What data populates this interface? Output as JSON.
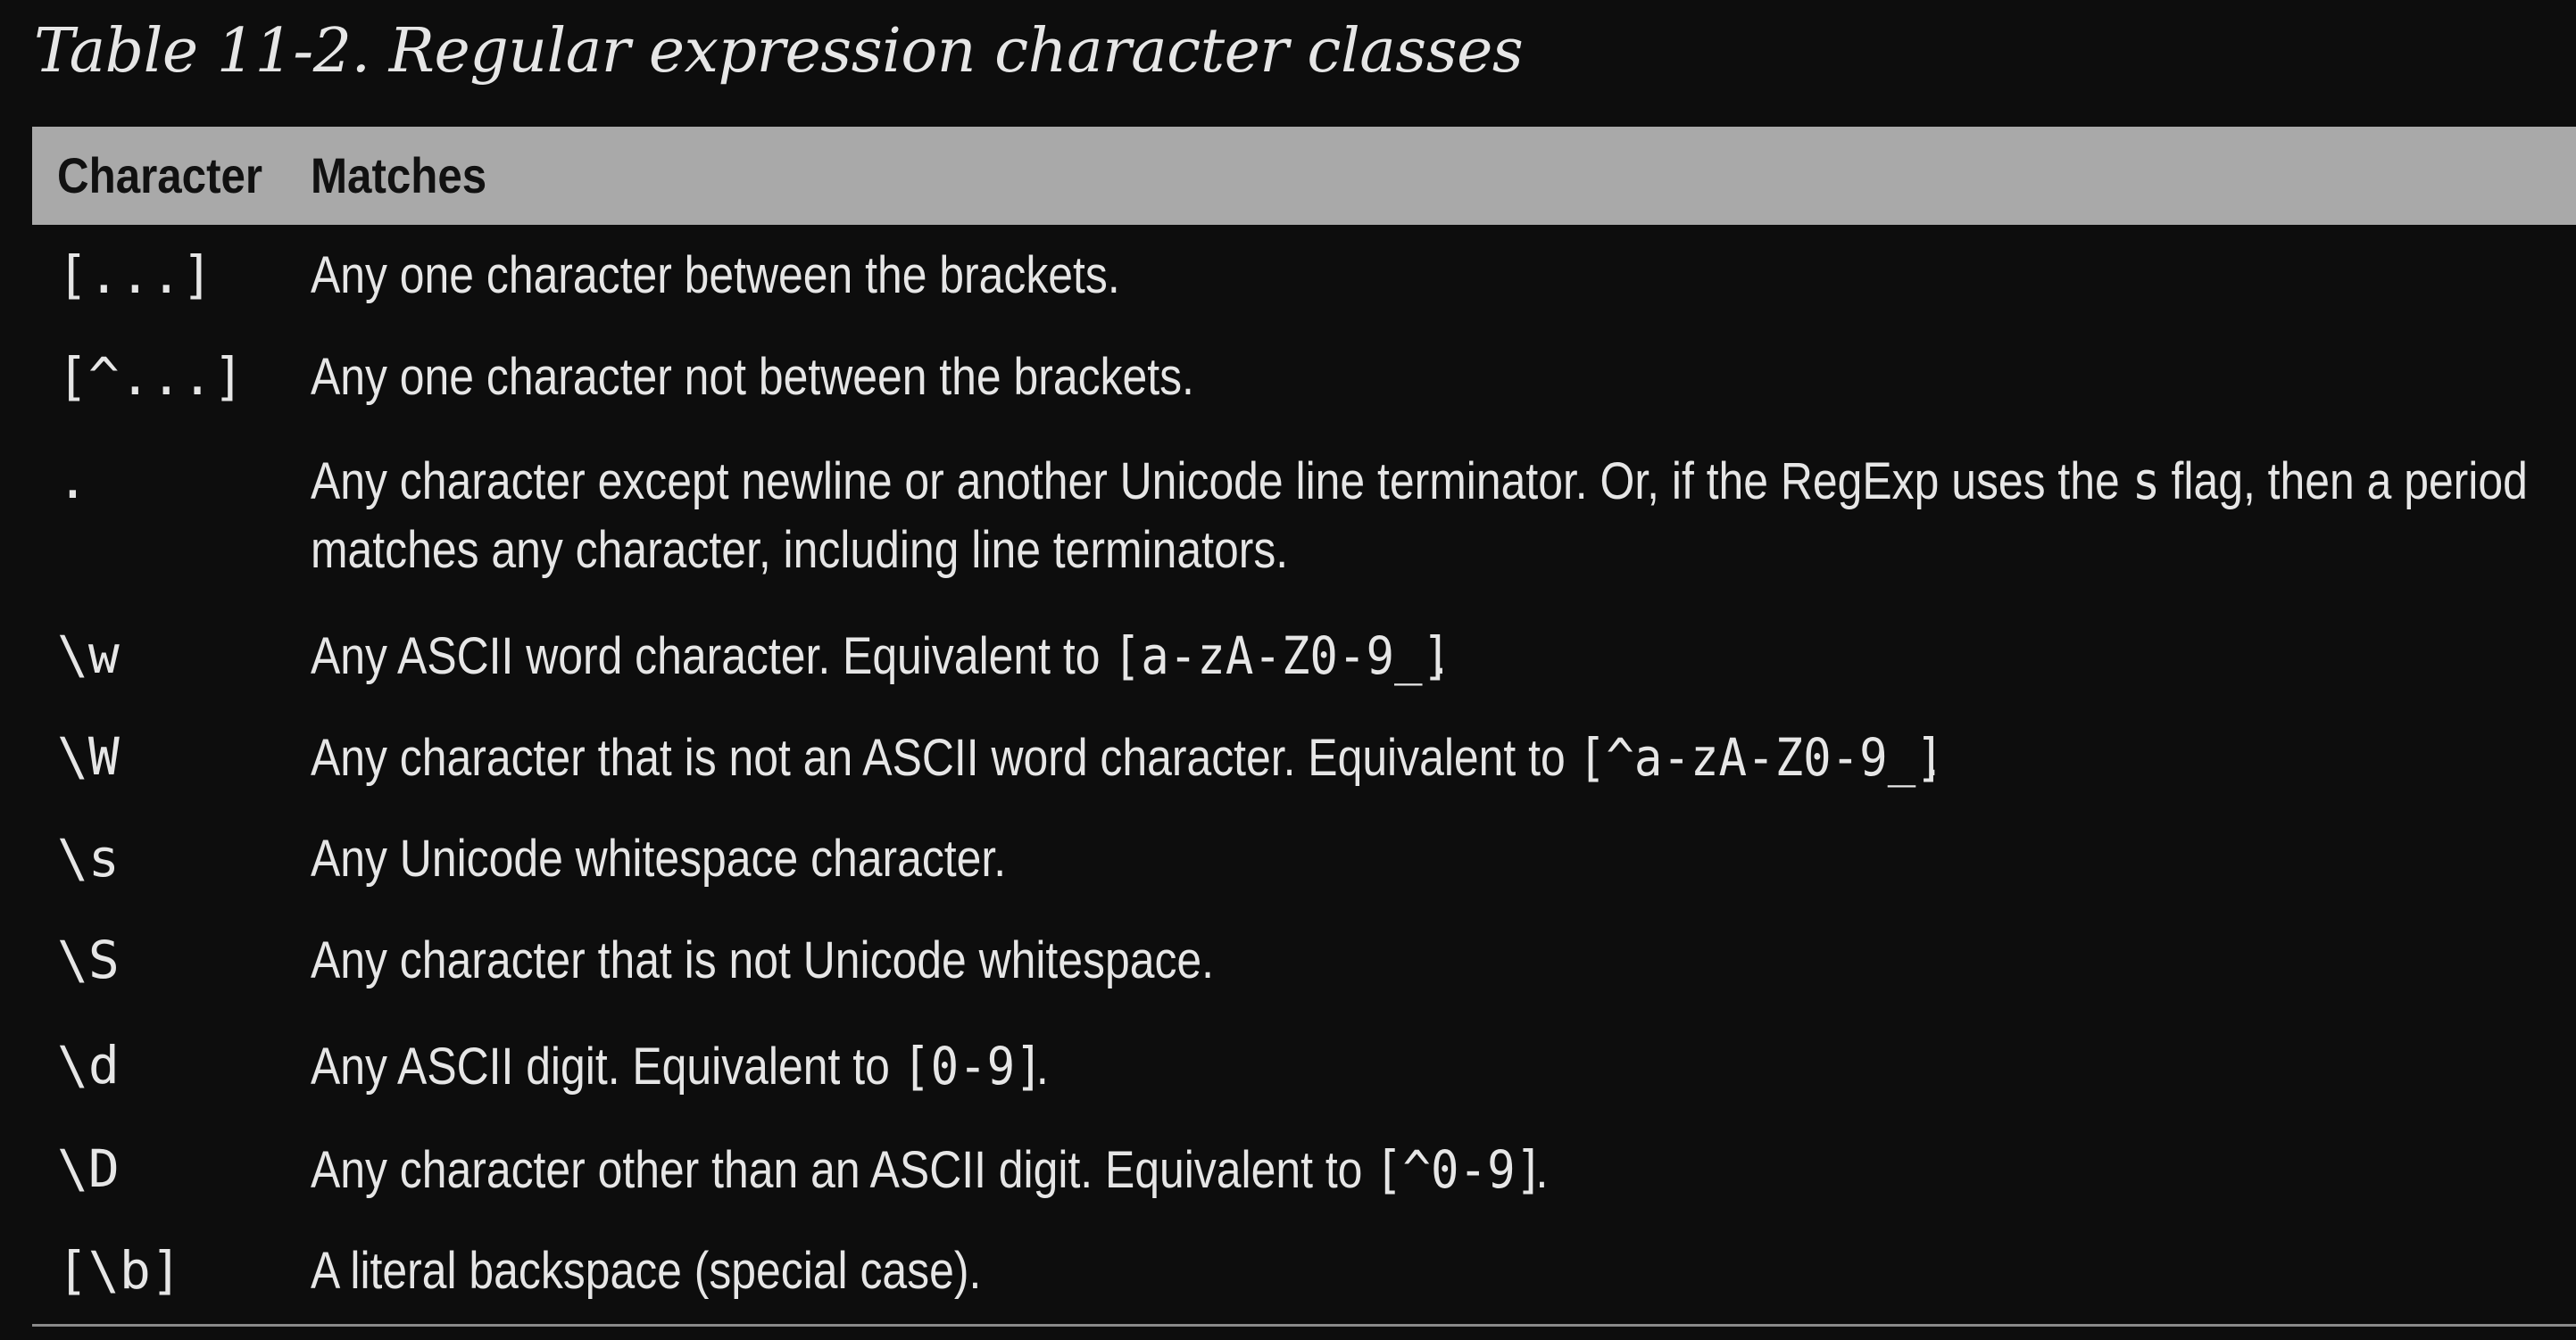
{
  "caption": "Table 11-2. Regular expression character classes",
  "table": {
    "headers": {
      "character": "Character",
      "matches": "Matches"
    },
    "rows": [
      {
        "character": "[...]",
        "lines": [
          [
            {
              "t": "Any one character between the brackets."
            }
          ]
        ]
      },
      {
        "character": "[^...]",
        "lines": [
          [
            {
              "t": "Any one character not between the brackets."
            }
          ]
        ]
      },
      {
        "character": ".",
        "lines": [
          [
            {
              "t": "Any character except newline or another Unicode line terminator. Or, if the RegExp uses the "
            },
            {
              "t": "s",
              "code": true
            },
            {
              "t": " flag, then a period"
            }
          ],
          [
            {
              "t": "matches any character, including line terminators."
            }
          ]
        ]
      },
      {
        "character": "\\w",
        "lines": [
          [
            {
              "t": "Any ASCII word character. Equivalent to "
            },
            {
              "t": "[a-zA-Z0-9_]",
              "code": true
            },
            {
              "t": "."
            }
          ]
        ]
      },
      {
        "character": "\\W",
        "lines": [
          [
            {
              "t": "Any character that is not an ASCII word character. Equivalent to "
            },
            {
              "t": "[^a-zA-Z0-9_]",
              "code": true
            },
            {
              "t": "."
            }
          ]
        ]
      },
      {
        "character": "\\s",
        "lines": [
          [
            {
              "t": "Any Unicode whitespace character."
            }
          ]
        ]
      },
      {
        "character": "\\S",
        "lines": [
          [
            {
              "t": "Any character that is not Unicode whitespace."
            }
          ]
        ]
      },
      {
        "character": "\\d",
        "lines": [
          [
            {
              "t": "Any ASCII digit. Equivalent to "
            },
            {
              "t": "[0-9]",
              "code": true
            },
            {
              "t": "."
            }
          ]
        ]
      },
      {
        "character": "\\D",
        "lines": [
          [
            {
              "t": "Any character other than an ASCII digit. Equivalent to "
            },
            {
              "t": "[^0-9]",
              "code": true
            },
            {
              "t": "."
            }
          ]
        ]
      },
      {
        "character": "[\\b]",
        "lines": [
          [
            {
              "t": "A literal backspace (special case)."
            }
          ]
        ]
      }
    ]
  }
}
